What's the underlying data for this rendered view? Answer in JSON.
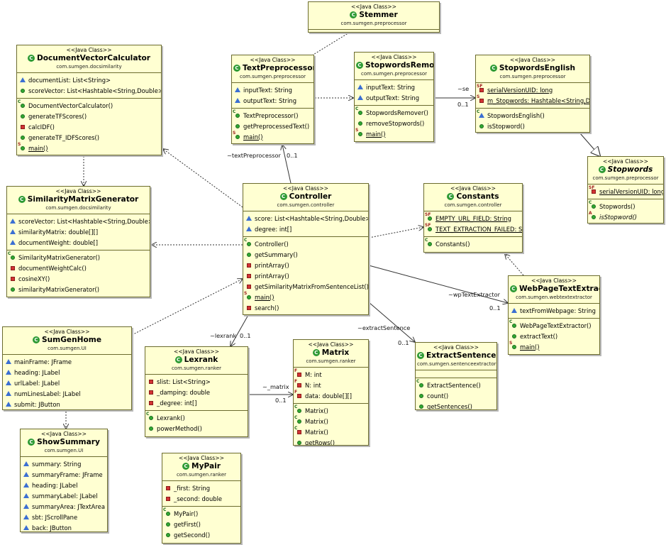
{
  "classes": [
    {
      "id": "stemmer",
      "stereotype": "<<Java Class>>",
      "name": "Stemmer",
      "package": "com.sumgen.preprocessor",
      "abstract": false,
      "attributes": [],
      "operations": []
    },
    {
      "id": "docvec",
      "stereotype": "<<Java Class>>",
      "name": "DocumentVectorCalculator",
      "package": "com.sumgen.docsimilarity",
      "abstract": false,
      "attributes": [
        {
          "vis": "package",
          "text": "documentList: List<String>"
        },
        {
          "vis": "public",
          "text": "scoreVector: List<Hashtable<String,Double>>"
        }
      ],
      "operations": [
        {
          "vis": "public",
          "mod": "C",
          "text": "DocumentVectorCalculator()"
        },
        {
          "vis": "public",
          "text": "generateTFScores()"
        },
        {
          "vis": "private",
          "text": "calcIDF()"
        },
        {
          "vis": "public",
          "text": "generateTF_IDFScores()"
        },
        {
          "vis": "public",
          "mod": "S",
          "text": "main()",
          "underline": true
        }
      ]
    },
    {
      "id": "textpre",
      "stereotype": "<<Java Class>>",
      "name": "TextPreprocessor",
      "package": "com.sumgen.preprocessor",
      "abstract": false,
      "attributes": [
        {
          "vis": "package",
          "text": "inputText: String"
        },
        {
          "vis": "package",
          "text": "outputText: String"
        }
      ],
      "operations": [
        {
          "vis": "public",
          "mod": "C",
          "text": "TextPreprocessor()"
        },
        {
          "vis": "public",
          "text": "getPreprocessedText()"
        },
        {
          "vis": "public",
          "mod": "S",
          "text": "main()",
          "underline": true
        }
      ]
    },
    {
      "id": "stopremover",
      "stereotype": "<<Java Class>>",
      "name": "StopwordsRemover",
      "package": "com.sumgen.preprocessor",
      "abstract": false,
      "attributes": [
        {
          "vis": "package",
          "text": "inputText: String"
        },
        {
          "vis": "package",
          "text": "outputText: String"
        }
      ],
      "operations": [
        {
          "vis": "public",
          "mod": "C",
          "text": "StopwordsRemover()"
        },
        {
          "vis": "public",
          "text": "removeStopwords()"
        },
        {
          "vis": "public",
          "mod": "S",
          "text": "main()",
          "underline": true
        }
      ]
    },
    {
      "id": "stopenglish",
      "stereotype": "<<Java Class>>",
      "name": "StopwordsEnglish",
      "package": "com.sumgen.preprocessor",
      "abstract": false,
      "attributes": [
        {
          "vis": "private",
          "mod": "SF",
          "text": "serialVersionUID: long",
          "underline": true
        },
        {
          "vis": "private",
          "mod": "S",
          "text": "m_Stopwords: Hashtable<String,Double>",
          "underline": true
        }
      ],
      "operations": [
        {
          "vis": "package",
          "mod": "C",
          "text": "StopwordsEnglish()"
        },
        {
          "vis": "public",
          "text": "isStopword()"
        }
      ]
    },
    {
      "id": "stopwords",
      "stereotype": "<<Java Class>>",
      "name": "Stopwords",
      "package": "com.sumgen.preprocessor",
      "abstract": true,
      "attributes": [
        {
          "vis": "private",
          "mod": "SF",
          "text": "serialVersionUID: long",
          "underline": true
        }
      ],
      "operations": [
        {
          "vis": "public",
          "mod": "C",
          "text": "Stopwords()"
        },
        {
          "vis": "public",
          "mod": "A",
          "text": "isStopword()",
          "italic": true
        }
      ]
    },
    {
      "id": "simgen",
      "stereotype": "<<Java Class>>",
      "name": "SimilarityMatrixGenerator",
      "package": "com.sumgen.docsimilarity",
      "abstract": false,
      "attributes": [
        {
          "vis": "package",
          "text": "scoreVector: List<Hashtable<String,Double>>"
        },
        {
          "vis": "package",
          "text": "similarityMatrix: double[][]"
        },
        {
          "vis": "package",
          "text": "documentWeight: double[]"
        }
      ],
      "operations": [
        {
          "vis": "public",
          "mod": "C",
          "text": "SimilarityMatrixGenerator()"
        },
        {
          "vis": "private",
          "text": "documentWeightCalc()"
        },
        {
          "vis": "private",
          "text": "cosineXY()"
        },
        {
          "vis": "public",
          "text": "similarityMatrixGenerator()"
        }
      ]
    },
    {
      "id": "controller",
      "stereotype": "<<Java Class>>",
      "name": "Controller",
      "package": "com.sumgen.controller",
      "abstract": false,
      "attributes": [
        {
          "vis": "package",
          "text": "score: List<Hashtable<String,Double>>"
        },
        {
          "vis": "package",
          "text": "degree: int[]"
        }
      ],
      "operations": [
        {
          "vis": "public",
          "mod": "C",
          "text": "Controller()"
        },
        {
          "vis": "public",
          "text": "getSummary()"
        },
        {
          "vis": "private",
          "text": "printArray()"
        },
        {
          "vis": "private",
          "text": "printArray()"
        },
        {
          "vis": "private",
          "text": "getSimilarityMatrixFromSentenceList()"
        },
        {
          "vis": "public",
          "mod": "S",
          "text": "main()",
          "underline": true
        },
        {
          "vis": "private",
          "text": "search()"
        }
      ]
    },
    {
      "id": "constants",
      "stereotype": "<<Java Class>>",
      "name": "Constants",
      "package": "com.sumgen.controller",
      "abstract": false,
      "attributes": [
        {
          "vis": "public",
          "mod": "SF",
          "text": "EMPTY_URL_FIELD: String",
          "underline": true
        },
        {
          "vis": "public",
          "mod": "SF",
          "text": "TEXT_EXTRACTION_FAILED: String",
          "underline": true
        }
      ],
      "operations": [
        {
          "vis": "public",
          "mod": "C",
          "text": "Constants()"
        }
      ]
    },
    {
      "id": "webpage",
      "stereotype": "<<Java Class>>",
      "name": "WebPageTextExtractor",
      "package": "com.sumgen.webtextextractor",
      "abstract": false,
      "attributes": [
        {
          "vis": "package",
          "text": "textFromWebpage: String"
        }
      ],
      "operations": [
        {
          "vis": "public",
          "mod": "C",
          "text": "WebPageTextExtractor()"
        },
        {
          "vis": "public",
          "text": "extractText()"
        },
        {
          "vis": "public",
          "mod": "S",
          "text": "main()",
          "underline": true
        }
      ]
    },
    {
      "id": "sumgenhome",
      "stereotype": "<<Java Class>>",
      "name": "SumGenHome",
      "package": "com.sumgen.UI",
      "abstract": false,
      "attributes": [
        {
          "vis": "package",
          "text": "mainFrame: JFrame"
        },
        {
          "vis": "package",
          "text": "heading: JLabel"
        },
        {
          "vis": "package",
          "text": "urlLabel: JLabel"
        },
        {
          "vis": "package",
          "text": "numLinesLabel: JLabel"
        },
        {
          "vis": "package",
          "text": "submit: JButton"
        }
      ],
      "operations": []
    },
    {
      "id": "lexrank",
      "stereotype": "<<Java Class>>",
      "name": "Lexrank",
      "package": "com.sumgen.ranker",
      "abstract": false,
      "attributes": [
        {
          "vis": "private",
          "text": "slist: List<String>"
        },
        {
          "vis": "private",
          "text": "_damping: double"
        },
        {
          "vis": "private",
          "text": "_degree: int[]"
        }
      ],
      "operations": [
        {
          "vis": "public",
          "mod": "C",
          "text": "Lexrank()"
        },
        {
          "vis": "public",
          "text": "powerMethod()"
        }
      ]
    },
    {
      "id": "matrix",
      "stereotype": "<<Java Class>>",
      "name": "Matrix",
      "package": "com.sumgen.ranker",
      "abstract": false,
      "attributes": [
        {
          "vis": "private",
          "mod": "F",
          "text": "M: int"
        },
        {
          "vis": "private",
          "mod": "F",
          "text": "N: int"
        },
        {
          "vis": "private",
          "mod": "F",
          "text": "data: double[][]"
        }
      ],
      "operations": [
        {
          "vis": "public",
          "mod": "C",
          "text": "Matrix()"
        },
        {
          "vis": "public",
          "mod": "C",
          "text": "Matrix()"
        },
        {
          "vis": "private",
          "mod": "C",
          "text": "Matrix()"
        },
        {
          "vis": "public",
          "text": "getRows()"
        }
      ]
    },
    {
      "id": "extract",
      "stereotype": "<<Java Class>>",
      "name": "ExtractSentence",
      "package": "com.sumgen.sentenceextractor",
      "abstract": false,
      "attributes": [],
      "operations": [
        {
          "vis": "public",
          "mod": "C",
          "text": "ExtractSentence()"
        },
        {
          "vis": "public",
          "text": "count()"
        },
        {
          "vis": "public",
          "text": "getSentences()"
        }
      ]
    },
    {
      "id": "showsummary",
      "stereotype": "<<Java Class>>",
      "name": "ShowSummary",
      "package": "com.sumgen.UI",
      "abstract": false,
      "attributes": [
        {
          "vis": "package",
          "text": "summary: String"
        },
        {
          "vis": "package",
          "text": "summaryFrame: JFrame"
        },
        {
          "vis": "package",
          "text": "heading: JLabel"
        },
        {
          "vis": "package",
          "text": "summaryLabel: JLabel"
        },
        {
          "vis": "package",
          "text": "summaryArea: JTextArea"
        },
        {
          "vis": "package",
          "text": "sbt: JScrollPane"
        },
        {
          "vis": "package",
          "text": "back: JButton"
        }
      ],
      "operations": []
    },
    {
      "id": "mypair",
      "stereotype": "<<Java Class>>",
      "name": "MyPair",
      "package": "com.sumgen.ranker",
      "abstract": false,
      "attributes": [
        {
          "vis": "private",
          "text": "_first: String"
        },
        {
          "vis": "private",
          "text": "_second: double"
        }
      ],
      "operations": [
        {
          "vis": "public",
          "mod": "C",
          "text": "MyPair()"
        },
        {
          "vis": "public",
          "text": "getFirst()"
        },
        {
          "vis": "public",
          "text": "getSecond()"
        }
      ]
    }
  ],
  "edge_labels": {
    "se": "~se",
    "se_mult": "0..1",
    "textpre": "~textPreprocessor",
    "textpre_mult": "0..1",
    "wp": "~wpTextExtractor",
    "wp_mult": "0..1",
    "es": "~extractSentence",
    "es_mult": "0..1",
    "lex": "~lexrank",
    "lex_mult": "0..1",
    "mat": "~_matrix",
    "mat_mult": "0..1"
  }
}
